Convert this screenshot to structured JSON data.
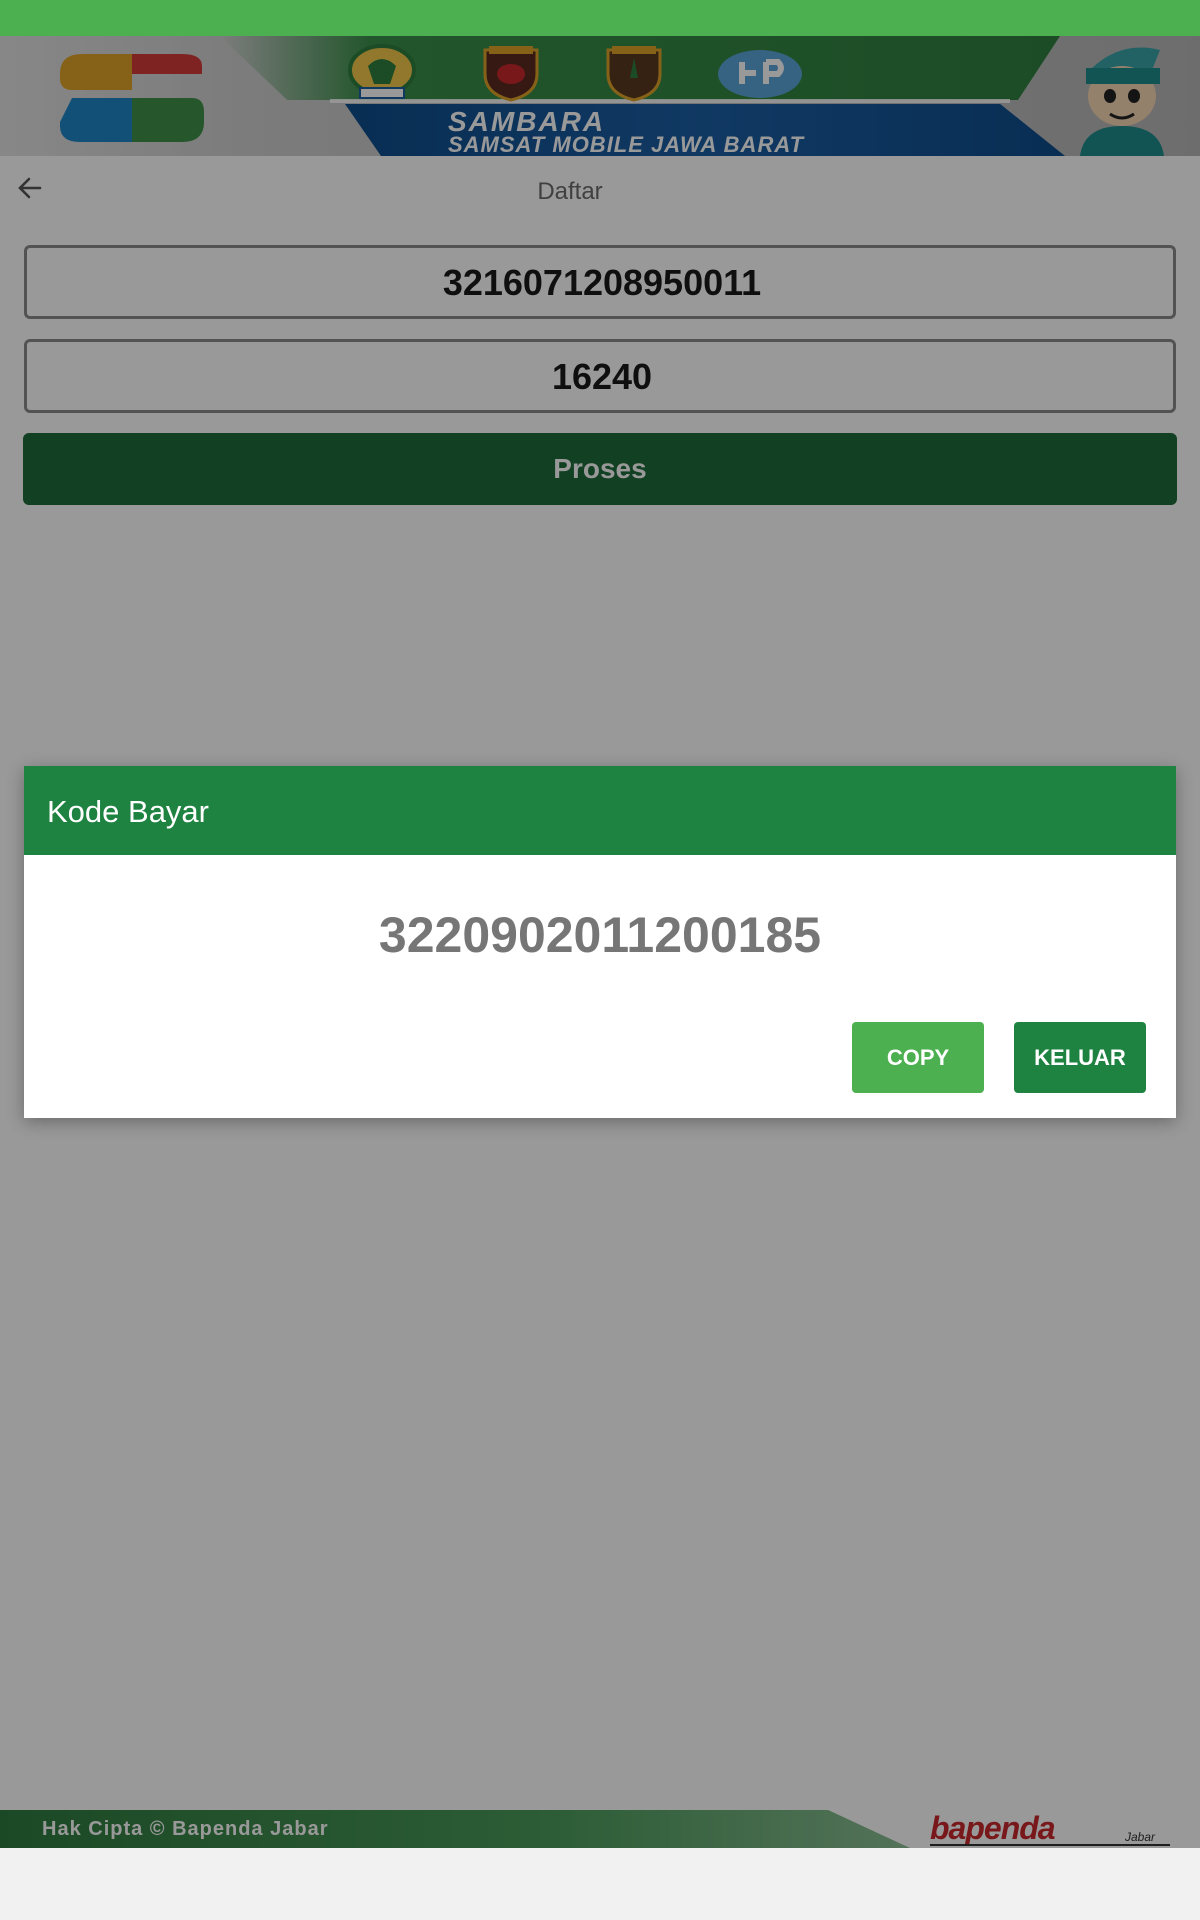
{
  "banner": {
    "title": "SAMBARA",
    "subtitle": "SAMSAT MOBILE JAWA BARAT"
  },
  "page": {
    "title": "Daftar"
  },
  "form": {
    "field1_value": "3216071208950011",
    "field2_value": "16240",
    "proses_label": "Proses"
  },
  "dialog": {
    "title": "Kode Bayar",
    "code": "3220902011200185",
    "copy_label": "COPY",
    "keluar_label": "KELUAR"
  },
  "footer": {
    "copyright": "Hak Cipta © Bapenda Jabar",
    "logo_text": "bapenda",
    "logo_sub": "Jabar"
  },
  "colors": {
    "status_bar": "#4caf50",
    "primary_green": "#1e8341",
    "copy_green": "#4caf50",
    "proses_green": "#1d6b3a"
  },
  "icons": {
    "back": "arrow-left-icon"
  }
}
